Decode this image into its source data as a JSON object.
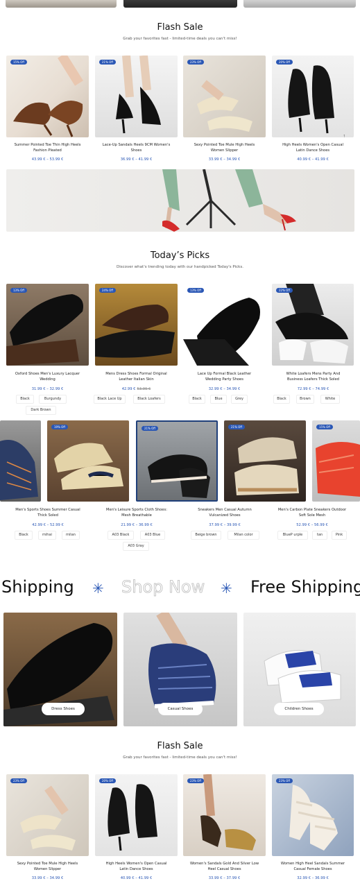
{
  "flash_sale_1": {
    "title": "Flash Sale",
    "subtitle": "Grab your favorites fast - limited-time deals you can't miss!",
    "products": [
      {
        "badge": "15% Off",
        "name_l1": "Summer Pointed Toe Thin High Heels",
        "name_l2": "Fashion Pleated",
        "price": "43.99 € – 53.99 €"
      },
      {
        "badge": "21% Off",
        "name_l1": "Lace-Up Sandals Heels 9CM Women's",
        "name_l2": "Shoes",
        "price": "36.99 € – 41.99 €"
      },
      {
        "badge": "23% Off",
        "name_l1": "Sexy Pointed Toe Mule High Heels",
        "name_l2": "Women Slipper",
        "price": "33.99 € – 34.99 €"
      },
      {
        "badge": "20% Off",
        "name_l1": "High Heels Women's Open Casual",
        "name_l2": "Latin Dance Shoes",
        "price": "40.99 € – 41.99 €"
      }
    ]
  },
  "todays_picks": {
    "title": "Today’s Picks",
    "subtitle": "Discover what's trending today with our handpicked Today's Picks.",
    "row1": [
      {
        "badge": "13% Off",
        "name_l1": "Oxford Shoes Men's Luxury Lacquer",
        "name_l2": "Wedding",
        "price": "31.99 € – 32.99 €",
        "chips": [
          "Black",
          "Burgundy",
          "Dark Brown"
        ]
      },
      {
        "badge": "24% Off",
        "name_l1": "Mens Dress Shoes Formal Original",
        "name_l2": "Leather Italian Skin",
        "price": "42.99 €",
        "old_price": "53.99 €",
        "chips": [
          "Black Lace Up",
          "Black Loafers"
        ]
      },
      {
        "badge": "13% Off",
        "name_l1": "Lace Up Formal Black Leather",
        "name_l2": "Wedding Party Shoes",
        "price": "32.99 € – 34.99 €",
        "chips": [
          "Black",
          "Blue",
          "Grey"
        ]
      },
      {
        "badge": "22% Off",
        "name_l1": "White Loafers Mens Party And",
        "name_l2": "Business Loafers Thick Soled",
        "price": "72.99 € – 74.99 €",
        "chips": [
          "Black",
          "Brown",
          "White"
        ]
      }
    ],
    "row2": [
      {
        "badge": "",
        "name_l1": "Men's Sports Shoes Summer Casual",
        "name_l2": "Thick Soled",
        "price": "42.99 € – 52.99 €",
        "chips": [
          "Black",
          "mihai",
          "milan"
        ]
      },
      {
        "badge": "19% Off",
        "name_l1": "Men's Leisure Sports Cloth Shoes:",
        "name_l2": "Mesh Breathable",
        "price": "21.99 € – 36.99 €",
        "chips": [
          "A03 Black",
          "A03 Blue",
          "A03 Gray"
        ]
      },
      {
        "badge": "21% Off",
        "name_l1": "Sneakers Men Casual Autumn",
        "name_l2": "Vulcanized Shoes",
        "price": "37.99 € – 39.99 €",
        "chips": [
          "Beige brown",
          "Milan color"
        ]
      },
      {
        "badge": "21% Off",
        "name_l1": "Men's Carbon Plate Sneakers Outdoor",
        "name_l2": "Soft Sole Mesh",
        "price": "52.99 € – 56.99 €",
        "chips": [
          "BlueP urple",
          "tan",
          "Pink"
        ]
      },
      {
        "badge": "15% Off"
      }
    ]
  },
  "marquee": {
    "items": [
      "Shipping",
      "Shop Now",
      "Free Shipping"
    ]
  },
  "categories": [
    {
      "label": "Dress Shoes"
    },
    {
      "label": "Casual Shoes"
    },
    {
      "label": "Children Shoes"
    }
  ],
  "flash_sale_2": {
    "title": "Flash Sale",
    "subtitle": "Grab your favorites fast - limited-time deals you can't miss!",
    "products": [
      {
        "badge": "23% Off",
        "name_l1": "Sexy Pointed Toe Mule High Heels",
        "name_l2": "Women Slipper",
        "price": "33.99 € – 34.99 €"
      },
      {
        "badge": "20% Off",
        "name_l1": "High Heels Women's Open Casual",
        "name_l2": "Latin Dance Shoes",
        "price": "40.99 € – 41.99 €"
      },
      {
        "badge": "23% Off",
        "name_l1": "Women's Sandals Gold And Silver Low",
        "name_l2": "Heel Casual Shoes",
        "price": "33.99 € – 37.99 €"
      },
      {
        "badge": "23% Off",
        "name_l1": "Women High Heel Sandals Summer",
        "name_l2": "Casual Female Shoes",
        "price": "32.99 € – 36.99 €"
      }
    ]
  },
  "colors": {
    "accent": "#2a57b5",
    "background": "#ffffff",
    "text": "#222222"
  }
}
